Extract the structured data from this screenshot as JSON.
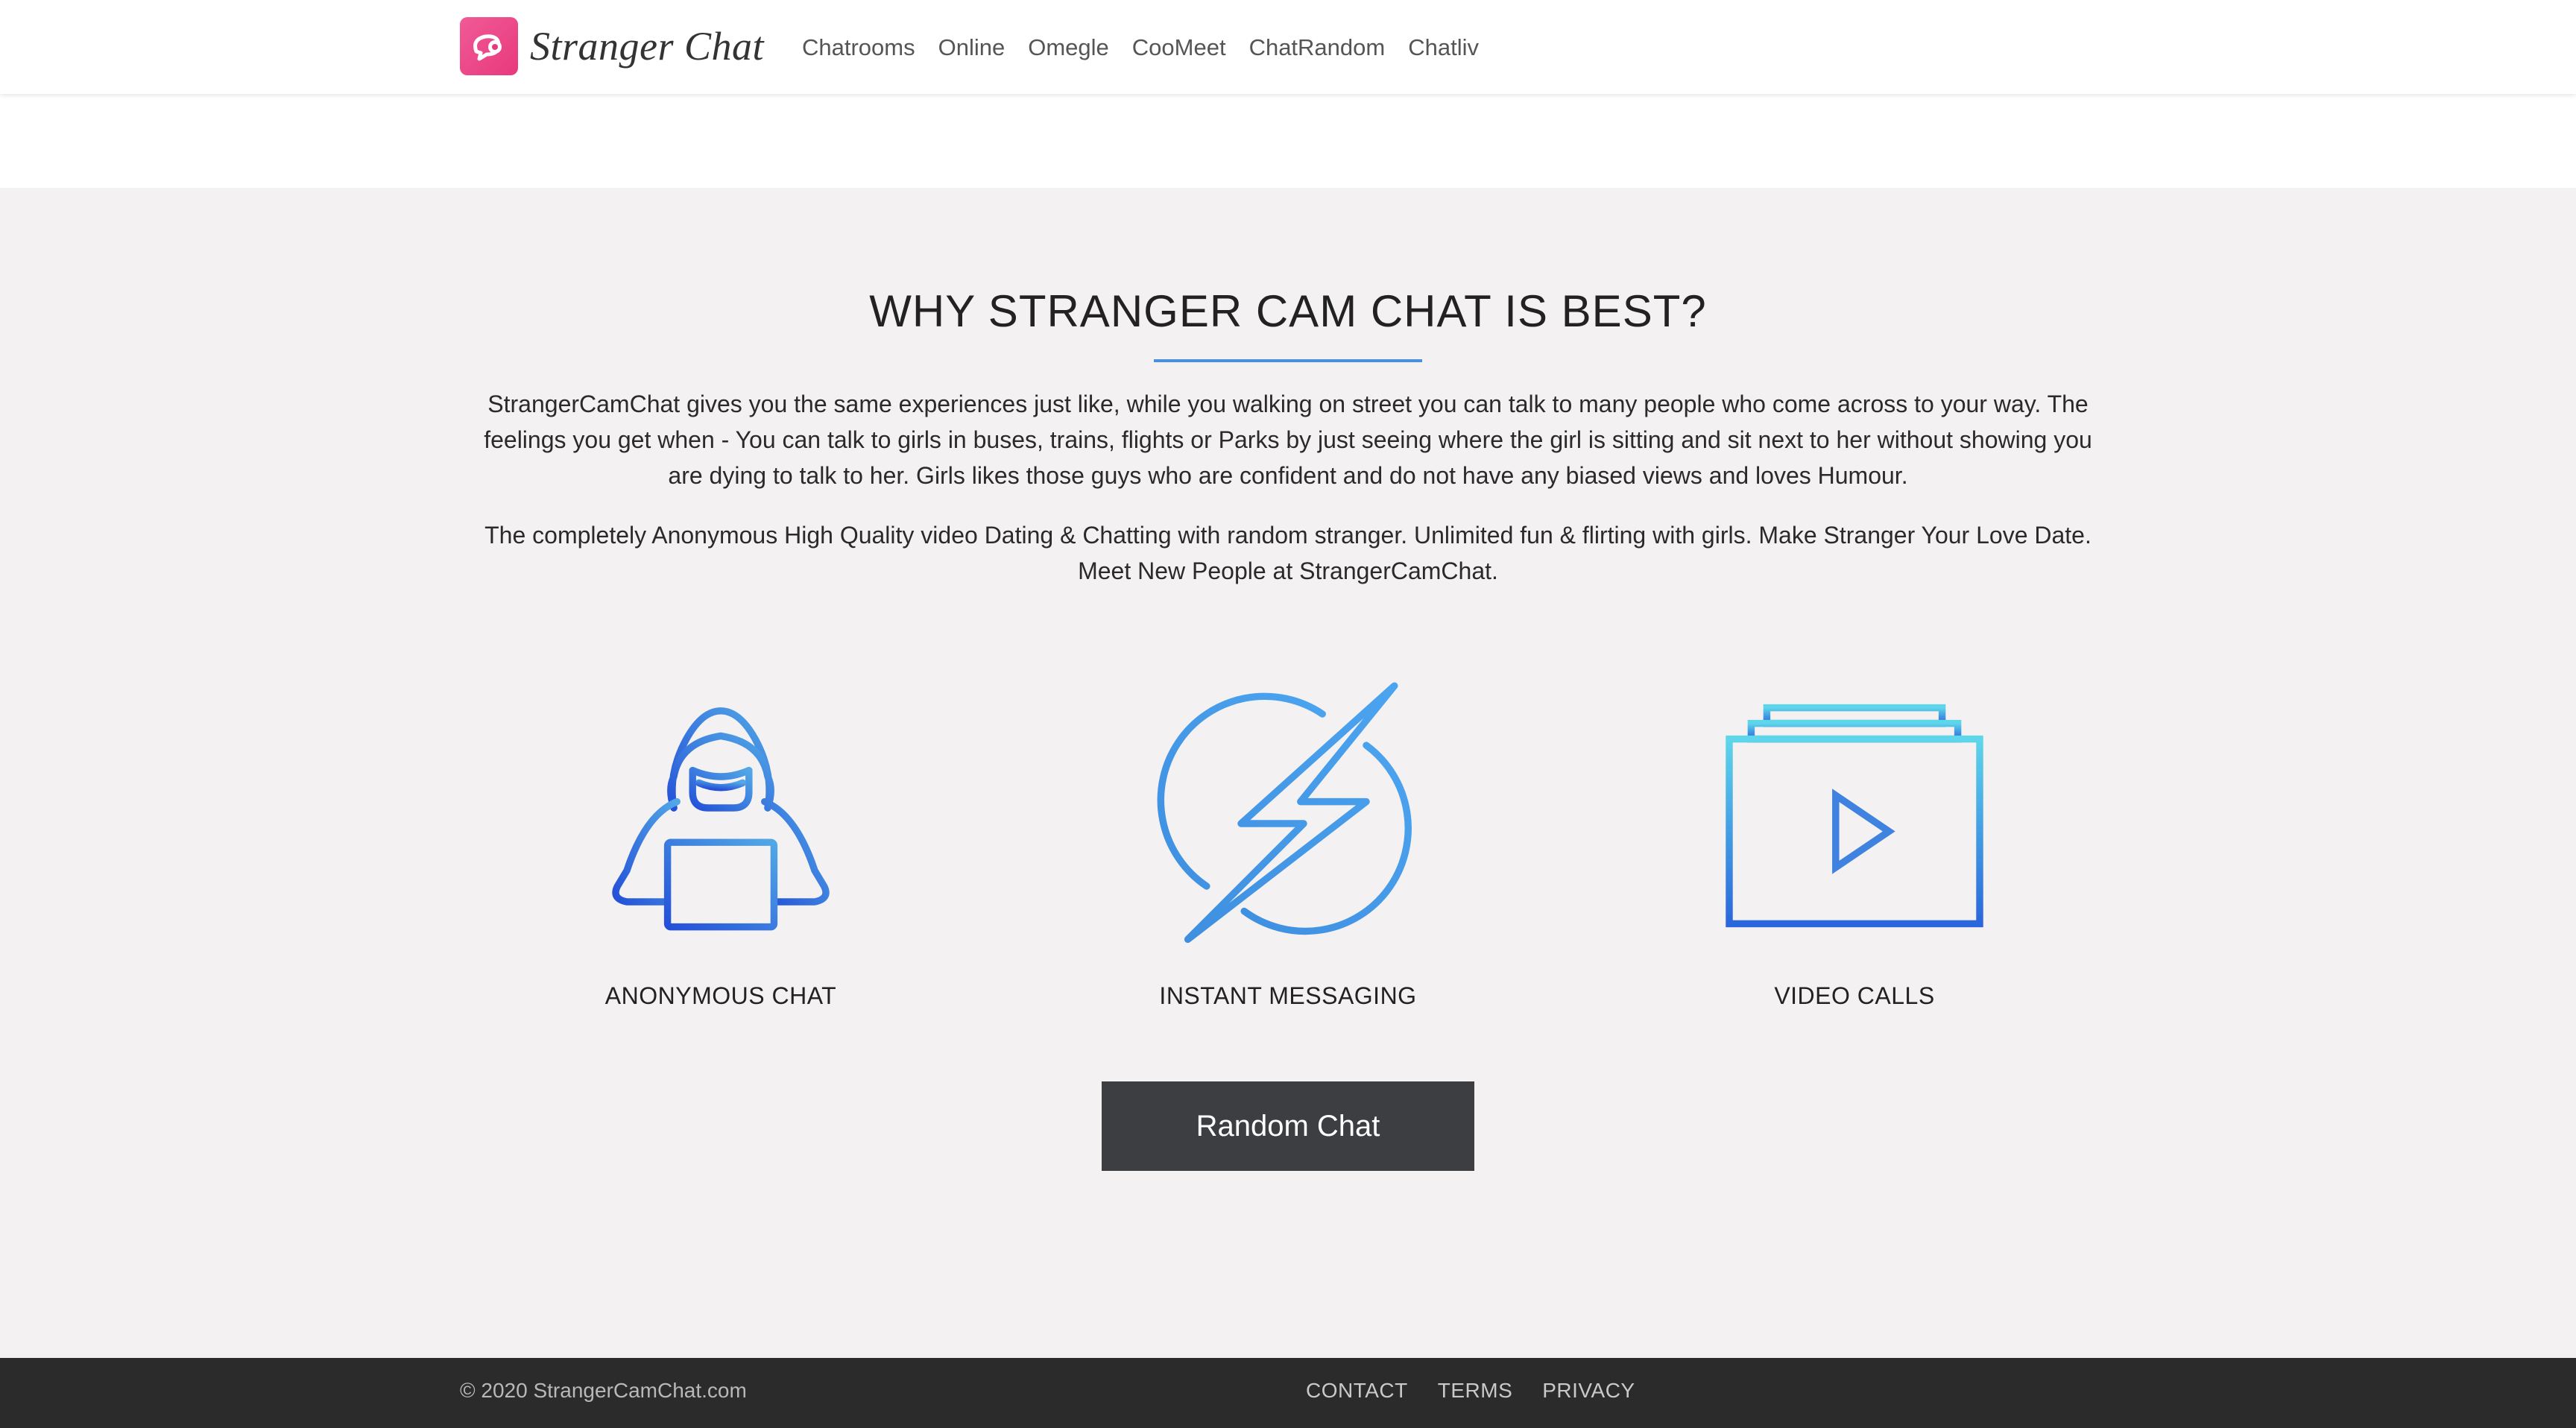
{
  "header": {
    "brand_name": "Stranger Chat",
    "logo_icon": "chat-bubble-icon",
    "nav": [
      {
        "label": "Chatrooms"
      },
      {
        "label": "Online"
      },
      {
        "label": "Omegle"
      },
      {
        "label": "CooMeet"
      },
      {
        "label": "ChatRandom"
      },
      {
        "label": "Chatliv"
      }
    ]
  },
  "main": {
    "title": "WHY STRANGER CAM CHAT IS BEST?",
    "paragraph1": "StrangerCamChat gives you the same experiences just like, while you walking on street you can talk to many people who come across to your way. The feelings you get when - You can talk to girls in buses, trains, flights or Parks by just seeing where the girl is sitting and sit next to her without showing you are dying to talk to her. Girls likes those guys who are confident and do not have any biased views and loves Humour.",
    "paragraph2": "The completely Anonymous High Quality video Dating & Chatting with random stranger. Unlimited fun & flirting with girls. Make Stranger Your Love Date. Meet New People at StrangerCamChat.",
    "features": [
      {
        "label": "ANONYMOUS CHAT",
        "icon": "hooded-user-laptop-icon"
      },
      {
        "label": "INSTANT MESSAGING",
        "icon": "lightning-bolt-icon"
      },
      {
        "label": "VIDEO CALLS",
        "icon": "video-play-icon"
      }
    ],
    "cta_label": "Random Chat"
  },
  "footer": {
    "copyright": "© 2020 StrangerCamChat.com",
    "links": [
      {
        "label": "CONTACT"
      },
      {
        "label": "TERMS"
      },
      {
        "label": "PRIVACY"
      }
    ]
  },
  "colors": {
    "brand_pink": "#ec4a8a",
    "accent_blue": "#4a90e2",
    "section_bg": "#f4f1f3",
    "button_bg": "#3d3e42",
    "footer_bg": "#2b2b2b"
  }
}
